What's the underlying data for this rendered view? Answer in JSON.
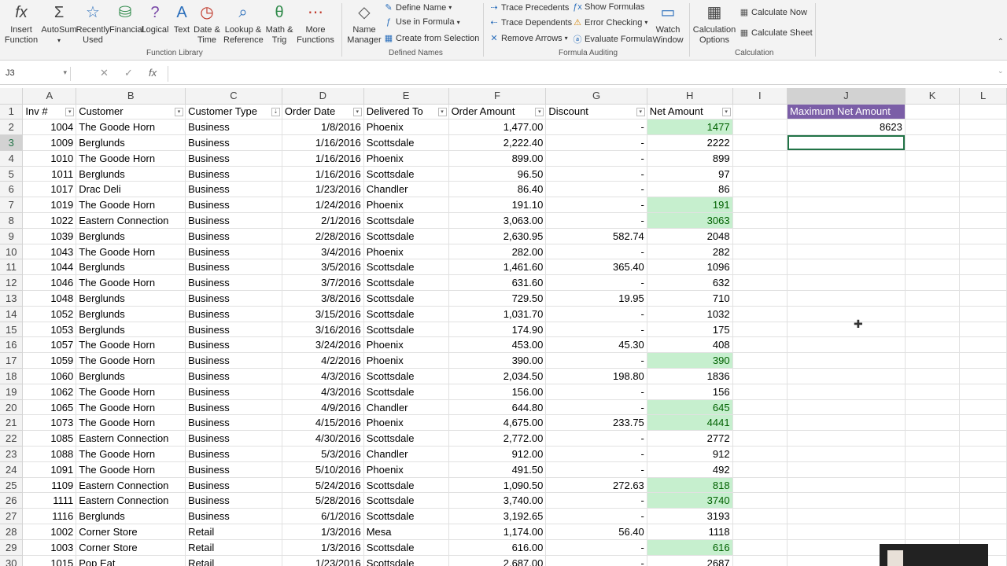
{
  "ribbon": {
    "buttons": [
      {
        "label": "Insert\nFunction",
        "icon": "fx-icon"
      },
      {
        "label": "AutoSum",
        "icon": "sigma-icon"
      },
      {
        "label": "Recently\nUsed",
        "icon": "star-icon"
      },
      {
        "label": "Financial",
        "icon": "database-icon"
      },
      {
        "label": "Logical",
        "icon": "question-book-icon"
      },
      {
        "label": "Text",
        "icon": "text-book-icon"
      },
      {
        "label": "Date &\nTime",
        "icon": "clock-icon"
      },
      {
        "label": "Lookup &\nReference",
        "icon": "lookup-icon"
      },
      {
        "label": "Math &\nTrig",
        "icon": "theta-icon"
      },
      {
        "label": "More\nFunctions",
        "icon": "more-icon"
      },
      {
        "label": "Name\nManager",
        "icon": "tag-icon"
      }
    ],
    "define_name": "Define Name",
    "use_in_formula": "Use in Formula",
    "create_from_selection": "Create from Selection",
    "trace_precedents": "Trace Precedents",
    "trace_dependents": "Trace Dependents",
    "remove_arrows": "Remove Arrows",
    "show_formulas": "Show Formulas",
    "error_checking": "Error Checking",
    "evaluate_formula": "Evaluate Formula",
    "watch_window": "Watch\nWindow",
    "calculation_options": "Calculation\nOptions",
    "calculate_now": "Calculate Now",
    "calculate_sheet": "Calculate Sheet",
    "groups": {
      "function_library": "Function Library",
      "defined_names": "Defined Names",
      "formula_auditing": "Formula Auditing",
      "calculation": "Calculation"
    }
  },
  "formula_bar": {
    "name_box": "J3",
    "formula": ""
  },
  "columns": [
    "A",
    "B",
    "C",
    "D",
    "E",
    "F",
    "G",
    "H",
    "I",
    "J",
    "K",
    "L"
  ],
  "headers": [
    "Inv #",
    "Customer",
    "Customer Type",
    "Order Date",
    "Delivered To",
    "Order Amount",
    "Discount",
    "Net Amount"
  ],
  "side": {
    "title": "Maximum Net Amount",
    "value": "8623"
  },
  "rows": [
    [
      "1004",
      "The Goode Horn",
      "Business",
      "1/8/2016",
      "Phoenix",
      "1,477.00",
      "-",
      "1477"
    ],
    [
      "1009",
      "Berglunds",
      "Business",
      "1/16/2016",
      "Scottsdale",
      "2,222.40",
      "-",
      "2222"
    ],
    [
      "1010",
      "The Goode Horn",
      "Business",
      "1/16/2016",
      "Phoenix",
      "899.00",
      "-",
      "899"
    ],
    [
      "1011",
      "Berglunds",
      "Business",
      "1/16/2016",
      "Scottsdale",
      "96.50",
      "-",
      "97"
    ],
    [
      "1017",
      "Drac Deli",
      "Business",
      "1/23/2016",
      "Chandler",
      "86.40",
      "-",
      "86"
    ],
    [
      "1019",
      "The Goode Horn",
      "Business",
      "1/24/2016",
      "Phoenix",
      "191.10",
      "-",
      "191"
    ],
    [
      "1022",
      "Eastern Connection",
      "Business",
      "2/1/2016",
      "Scottsdale",
      "3,063.00",
      "-",
      "3063"
    ],
    [
      "1039",
      "Berglunds",
      "Business",
      "2/28/2016",
      "Scottsdale",
      "2,630.95",
      "582.74",
      "2048"
    ],
    [
      "1043",
      "The Goode Horn",
      "Business",
      "3/4/2016",
      "Phoenix",
      "282.00",
      "-",
      "282"
    ],
    [
      "1044",
      "Berglunds",
      "Business",
      "3/5/2016",
      "Scottsdale",
      "1,461.60",
      "365.40",
      "1096"
    ],
    [
      "1046",
      "The Goode Horn",
      "Business",
      "3/7/2016",
      "Scottsdale",
      "631.60",
      "-",
      "632"
    ],
    [
      "1048",
      "Berglunds",
      "Business",
      "3/8/2016",
      "Scottsdale",
      "729.50",
      "19.95",
      "710"
    ],
    [
      "1052",
      "Berglunds",
      "Business",
      "3/15/2016",
      "Scottsdale",
      "1,031.70",
      "-",
      "1032"
    ],
    [
      "1053",
      "Berglunds",
      "Business",
      "3/16/2016",
      "Scottsdale",
      "174.90",
      "-",
      "175"
    ],
    [
      "1057",
      "The Goode Horn",
      "Business",
      "3/24/2016",
      "Phoenix",
      "453.00",
      "45.30",
      "408"
    ],
    [
      "1059",
      "The Goode Horn",
      "Business",
      "4/2/2016",
      "Phoenix",
      "390.00",
      "-",
      "390"
    ],
    [
      "1060",
      "Berglunds",
      "Business",
      "4/3/2016",
      "Scottsdale",
      "2,034.50",
      "198.80",
      "1836"
    ],
    [
      "1062",
      "The Goode Horn",
      "Business",
      "4/3/2016",
      "Scottsdale",
      "156.00",
      "-",
      "156"
    ],
    [
      "1065",
      "The Goode Horn",
      "Business",
      "4/9/2016",
      "Chandler",
      "644.80",
      "-",
      "645"
    ],
    [
      "1073",
      "The Goode Horn",
      "Business",
      "4/15/2016",
      "Phoenix",
      "4,675.00",
      "233.75",
      "4441"
    ],
    [
      "1085",
      "Eastern Connection",
      "Business",
      "4/30/2016",
      "Scottsdale",
      "2,772.00",
      "-",
      "2772"
    ],
    [
      "1088",
      "The Goode Horn",
      "Business",
      "5/3/2016",
      "Chandler",
      "912.00",
      "-",
      "912"
    ],
    [
      "1091",
      "The Goode Horn",
      "Business",
      "5/10/2016",
      "Phoenix",
      "491.50",
      "-",
      "492"
    ],
    [
      "1109",
      "Eastern Connection",
      "Business",
      "5/24/2016",
      "Scottsdale",
      "1,090.50",
      "272.63",
      "818"
    ],
    [
      "1111",
      "Eastern Connection",
      "Business",
      "5/28/2016",
      "Scottsdale",
      "3,740.00",
      "-",
      "3740"
    ],
    [
      "1116",
      "Berglunds",
      "Business",
      "6/1/2016",
      "Scottsdale",
      "3,192.65",
      "-",
      "3193"
    ],
    [
      "1002",
      "Corner Store",
      "Retail",
      "1/3/2016",
      "Mesa",
      "1,174.00",
      "56.40",
      "1118"
    ],
    [
      "1003",
      "Corner Store",
      "Retail",
      "1/3/2016",
      "Scottsdale",
      "616.00",
      "-",
      "616"
    ],
    [
      "1015",
      "Pop Eat",
      "Retail",
      "1/23/2016",
      "Scottsdale",
      "2,687.00",
      "-",
      "2687"
    ]
  ],
  "highlight_rows": [
    2,
    7,
    8,
    17,
    20,
    21,
    25,
    26,
    29
  ],
  "colors": {
    "highlight_fill": "#c6efce",
    "highlight_text": "#006100",
    "header_fill": "#7b5ea7",
    "accent": "#217346"
  }
}
